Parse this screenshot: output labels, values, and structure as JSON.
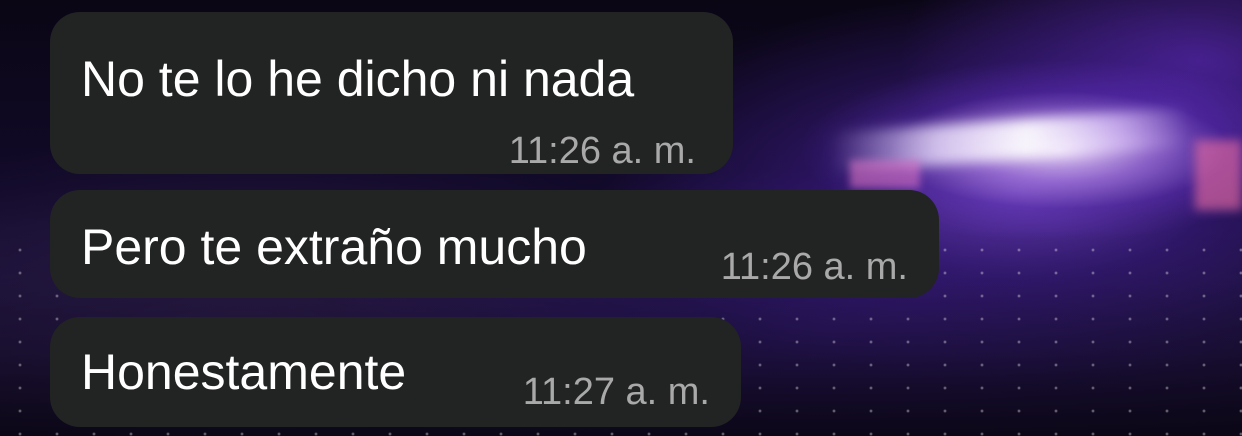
{
  "chat": {
    "wallpaper": "concert-stage-photo",
    "bubble_color": "#222423",
    "text_color": "#ffffff",
    "time_color": "#a9a9a9",
    "messages": [
      {
        "text": "No te lo he dicho ni nada",
        "time": "11:26 a. m."
      },
      {
        "text": "Pero te extraño mucho",
        "time": "11:26 a. m."
      },
      {
        "text": "Honestamente",
        "time": "11:27 a. m."
      }
    ]
  }
}
